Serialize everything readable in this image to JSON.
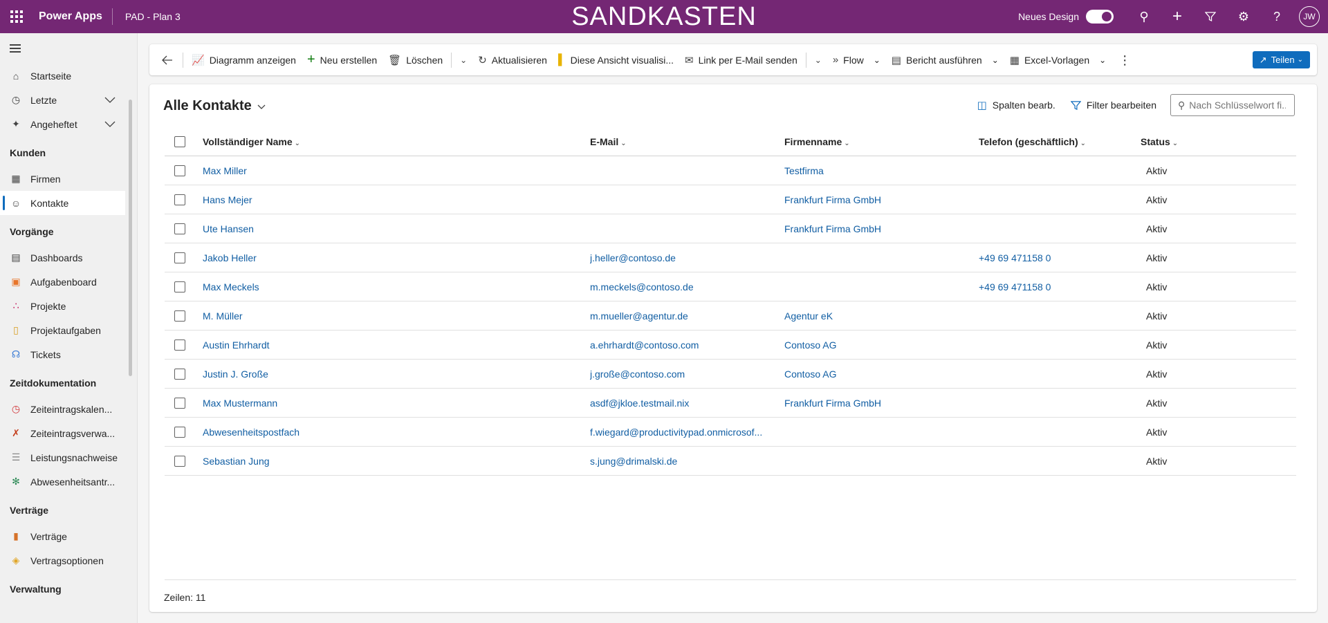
{
  "topbar": {
    "app_name": "Power Apps",
    "env_name": "PAD - Plan 3",
    "env_title": "SANDKASTEN",
    "new_design_label": "Neues Design",
    "avatar_initials": "JW"
  },
  "sidebar": {
    "items_top": [
      {
        "label": "Startseite",
        "icon": "home-icon"
      },
      {
        "label": "Letzte",
        "icon": "clock-icon",
        "expandable": true
      },
      {
        "label": "Angeheftet",
        "icon": "pin-icon",
        "expandable": true
      }
    ],
    "sections": [
      {
        "title": "Kunden",
        "items": [
          {
            "label": "Firmen",
            "icon": "building-icon"
          },
          {
            "label": "Kontakte",
            "icon": "person-icon",
            "active": true
          }
        ]
      },
      {
        "title": "Vorgänge",
        "items": [
          {
            "label": "Dashboards",
            "icon": "dashboard-icon"
          },
          {
            "label": "Aufgabenboard",
            "icon": "board-icon"
          },
          {
            "label": "Projekte",
            "icon": "project-icon"
          },
          {
            "label": "Projektaufgaben",
            "icon": "clipboard-icon"
          },
          {
            "label": "Tickets",
            "icon": "headset-icon"
          }
        ]
      },
      {
        "title": "Zeitdokumentation",
        "items": [
          {
            "label": "Zeiteintragskalen...",
            "icon": "alarm-icon"
          },
          {
            "label": "Zeiteintragsverwa...",
            "icon": "tools-icon"
          },
          {
            "label": "Leistungsnachweise",
            "icon": "document-icon"
          },
          {
            "label": "Abwesenheitsantr...",
            "icon": "palm-tree-icon"
          }
        ]
      },
      {
        "title": "Verträge",
        "items": [
          {
            "label": "Verträge",
            "icon": "books-icon"
          },
          {
            "label": "Vertragsoptionen",
            "icon": "tag-icon"
          }
        ]
      },
      {
        "title": "Verwaltung",
        "items": []
      }
    ]
  },
  "commandbar": {
    "show_chart": "Diagramm anzeigen",
    "new": "Neu erstellen",
    "delete": "Löschen",
    "refresh": "Aktualisieren",
    "visualize": "Diese Ansicht visualisi...",
    "email_link": "Link per E-Mail senden",
    "flow": "Flow",
    "run_report": "Bericht ausführen",
    "excel_templates": "Excel-Vorlagen",
    "share": "Teilen"
  },
  "view": {
    "title": "Alle Kontakte",
    "edit_columns": "Spalten bearb.",
    "edit_filters": "Filter bearbeiten",
    "search_placeholder": "Nach Schlüsselwort fi...",
    "rows_label": "Zeilen: 11"
  },
  "grid": {
    "columns": {
      "name": "Vollständiger Name",
      "email": "E-Mail",
      "company": "Firmenname",
      "phone": "Telefon (geschäftlich)",
      "status": "Status"
    },
    "rows": [
      {
        "name": "Max Miller",
        "email": "",
        "company": "Testfirma",
        "phone": "",
        "status": "Aktiv"
      },
      {
        "name": "Hans Mejer",
        "email": "",
        "company": "Frankfurt Firma GmbH",
        "phone": "",
        "status": "Aktiv"
      },
      {
        "name": "Ute Hansen",
        "email": "",
        "company": "Frankfurt Firma GmbH",
        "phone": "",
        "status": "Aktiv"
      },
      {
        "name": "Jakob Heller",
        "email": "j.heller@contoso.de",
        "company": "",
        "phone": "+49 69 471158 0",
        "status": "Aktiv"
      },
      {
        "name": "Max Meckels",
        "email": "m.meckels@contoso.de",
        "company": "",
        "phone": "+49 69 471158 0",
        "status": "Aktiv"
      },
      {
        "name": "M. Müller",
        "email": "m.mueller@agentur.de",
        "company": "Agentur eK",
        "phone": "",
        "status": "Aktiv"
      },
      {
        "name": "Austin Ehrhardt",
        "email": "a.ehrhardt@contoso.com",
        "company": "Contoso AG",
        "phone": "",
        "status": "Aktiv"
      },
      {
        "name": "Justin J. Große",
        "email": "j.große@contoso.com",
        "company": "Contoso AG",
        "phone": "",
        "status": "Aktiv"
      },
      {
        "name": "Max Mustermann",
        "email": "asdf@jkloe.testmail.nix",
        "company": "Frankfurt Firma GmbH",
        "phone": "",
        "status": "Aktiv"
      },
      {
        "name": "Abwesenheitspostfach",
        "email": "f.wiegard@productivitypad.onmicrosof...",
        "company": "",
        "phone": "",
        "status": "Aktiv"
      },
      {
        "name": "Sebastian Jung",
        "email": "s.jung@drimalski.de",
        "company": "",
        "phone": "",
        "status": "Aktiv"
      }
    ]
  }
}
